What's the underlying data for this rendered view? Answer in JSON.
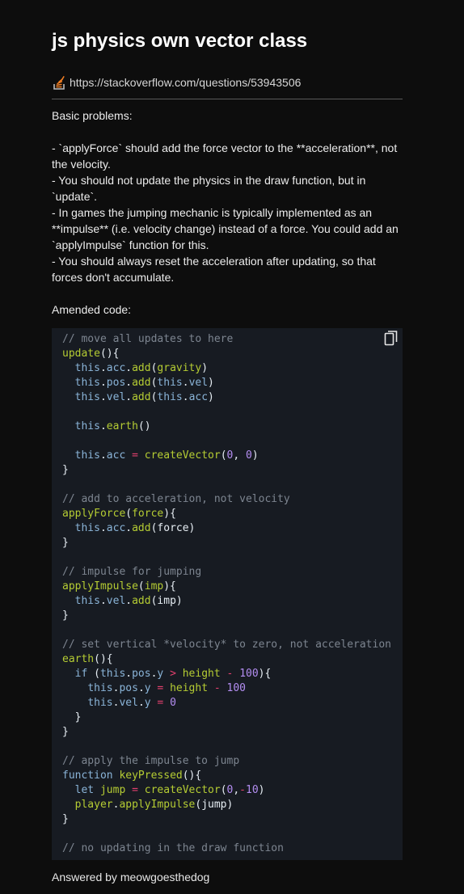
{
  "page": {
    "title": "js physics own vector class",
    "source_url": "https://stackoverflow.com/questions/53943506",
    "source_icon": "stackoverflow-icon"
  },
  "answer": {
    "intro": "Basic problems:",
    "bullets": [
      "- `applyForce` should add the force vector to the **acceleration**, not the velocity.",
      "- You should not update the physics in the draw function, but in `update`.",
      "- In games the jumping mechanic is typically implemented as an **impulse** (i.e. velocity change) instead of a force. You could add an `applyImpulse` function for this.",
      "- You should always reset the acceleration after updating, so that forces don't accumulate."
    ],
    "amended_label": "Amended code:"
  },
  "code": {
    "copy_icon": "copy-icon",
    "lines": [
      [
        [
          "c",
          "// move all updates to here"
        ]
      ],
      [
        [
          "f",
          "update"
        ],
        [
          "p",
          "(){"
        ]
      ],
      [
        [
          "p",
          "  "
        ],
        [
          "t",
          "this"
        ],
        [
          "p",
          "."
        ],
        [
          "t",
          "acc"
        ],
        [
          "p",
          "."
        ],
        [
          "f",
          "add"
        ],
        [
          "p",
          "("
        ],
        [
          "i",
          "gravity"
        ],
        [
          "p",
          ")"
        ]
      ],
      [
        [
          "p",
          "  "
        ],
        [
          "t",
          "this"
        ],
        [
          "p",
          "."
        ],
        [
          "t",
          "pos"
        ],
        [
          "p",
          "."
        ],
        [
          "f",
          "add"
        ],
        [
          "p",
          "("
        ],
        [
          "t",
          "this"
        ],
        [
          "p",
          "."
        ],
        [
          "t",
          "vel"
        ],
        [
          "p",
          ")"
        ]
      ],
      [
        [
          "p",
          "  "
        ],
        [
          "t",
          "this"
        ],
        [
          "p",
          "."
        ],
        [
          "t",
          "vel"
        ],
        [
          "p",
          "."
        ],
        [
          "f",
          "add"
        ],
        [
          "p",
          "("
        ],
        [
          "t",
          "this"
        ],
        [
          "p",
          "."
        ],
        [
          "t",
          "acc"
        ],
        [
          "p",
          ")"
        ]
      ],
      [],
      [
        [
          "p",
          "  "
        ],
        [
          "t",
          "this"
        ],
        [
          "p",
          "."
        ],
        [
          "f",
          "earth"
        ],
        [
          "p",
          "()"
        ]
      ],
      [],
      [
        [
          "p",
          "  "
        ],
        [
          "t",
          "this"
        ],
        [
          "p",
          "."
        ],
        [
          "t",
          "acc"
        ],
        [
          "p",
          " "
        ],
        [
          "o",
          "="
        ],
        [
          "p",
          " "
        ],
        [
          "f",
          "createVector"
        ],
        [
          "p",
          "("
        ],
        [
          "n",
          "0"
        ],
        [
          "p",
          ", "
        ],
        [
          "n",
          "0"
        ],
        [
          "p",
          ")"
        ]
      ],
      [
        [
          "p",
          "}"
        ]
      ],
      [],
      [
        [
          "c",
          "// add to acceleration, not velocity"
        ]
      ],
      [
        [
          "f",
          "applyForce"
        ],
        [
          "p",
          "("
        ],
        [
          "i",
          "force"
        ],
        [
          "p",
          "){"
        ]
      ],
      [
        [
          "p",
          "  "
        ],
        [
          "t",
          "this"
        ],
        [
          "p",
          "."
        ],
        [
          "t",
          "acc"
        ],
        [
          "p",
          "."
        ],
        [
          "f",
          "add"
        ],
        [
          "p",
          "(force)"
        ]
      ],
      [
        [
          "p",
          "}"
        ]
      ],
      [],
      [
        [
          "c",
          "// impulse for jumping"
        ]
      ],
      [
        [
          "f",
          "applyImpulse"
        ],
        [
          "p",
          "("
        ],
        [
          "i",
          "imp"
        ],
        [
          "p",
          "){"
        ]
      ],
      [
        [
          "p",
          "  "
        ],
        [
          "t",
          "this"
        ],
        [
          "p",
          "."
        ],
        [
          "t",
          "vel"
        ],
        [
          "p",
          "."
        ],
        [
          "f",
          "add"
        ],
        [
          "p",
          "(imp)"
        ]
      ],
      [
        [
          "p",
          "}"
        ]
      ],
      [],
      [
        [
          "c",
          "// set vertical *velocity* to zero, not acceleration"
        ]
      ],
      [
        [
          "f",
          "earth"
        ],
        [
          "p",
          "(){"
        ]
      ],
      [
        [
          "p",
          "  "
        ],
        [
          "k",
          "if"
        ],
        [
          "p",
          " ("
        ],
        [
          "t",
          "this"
        ],
        [
          "p",
          "."
        ],
        [
          "t",
          "pos"
        ],
        [
          "p",
          "."
        ],
        [
          "t",
          "y"
        ],
        [
          "p",
          " "
        ],
        [
          "o",
          ">"
        ],
        [
          "p",
          " "
        ],
        [
          "i",
          "height"
        ],
        [
          "p",
          " "
        ],
        [
          "o",
          "-"
        ],
        [
          "p",
          " "
        ],
        [
          "n",
          "100"
        ],
        [
          "p",
          "){"
        ]
      ],
      [
        [
          "p",
          "    "
        ],
        [
          "t",
          "this"
        ],
        [
          "p",
          "."
        ],
        [
          "t",
          "pos"
        ],
        [
          "p",
          "."
        ],
        [
          "t",
          "y"
        ],
        [
          "p",
          " "
        ],
        [
          "o",
          "="
        ],
        [
          "p",
          " "
        ],
        [
          "i",
          "height"
        ],
        [
          "p",
          " "
        ],
        [
          "o",
          "-"
        ],
        [
          "p",
          " "
        ],
        [
          "n",
          "100"
        ]
      ],
      [
        [
          "p",
          "    "
        ],
        [
          "t",
          "this"
        ],
        [
          "p",
          "."
        ],
        [
          "t",
          "vel"
        ],
        [
          "p",
          "."
        ],
        [
          "t",
          "y"
        ],
        [
          "p",
          " "
        ],
        [
          "o",
          "="
        ],
        [
          "p",
          " "
        ],
        [
          "n",
          "0"
        ]
      ],
      [
        [
          "p",
          "  }"
        ]
      ],
      [
        [
          "p",
          "}"
        ]
      ],
      [],
      [
        [
          "c",
          "// apply the impulse to jump"
        ]
      ],
      [
        [
          "k",
          "function"
        ],
        [
          "p",
          " "
        ],
        [
          "f",
          "keyPressed"
        ],
        [
          "p",
          "(){"
        ]
      ],
      [
        [
          "p",
          "  "
        ],
        [
          "k",
          "let"
        ],
        [
          "p",
          " "
        ],
        [
          "i",
          "jump"
        ],
        [
          "p",
          " "
        ],
        [
          "o",
          "="
        ],
        [
          "p",
          " "
        ],
        [
          "f",
          "createVector"
        ],
        [
          "p",
          "("
        ],
        [
          "n",
          "0"
        ],
        [
          "p",
          ","
        ],
        [
          "o",
          "-"
        ],
        [
          "n",
          "10"
        ],
        [
          "p",
          ")"
        ]
      ],
      [
        [
          "p",
          "  "
        ],
        [
          "i",
          "player"
        ],
        [
          "p",
          "."
        ],
        [
          "f",
          "applyImpulse"
        ],
        [
          "p",
          "(jump)"
        ]
      ],
      [
        [
          "p",
          "}"
        ]
      ],
      [],
      [
        [
          "c",
          "// no updating in the draw function"
        ]
      ]
    ]
  },
  "footer": {
    "answered_by": "Answered by meowgoesthedog"
  }
}
